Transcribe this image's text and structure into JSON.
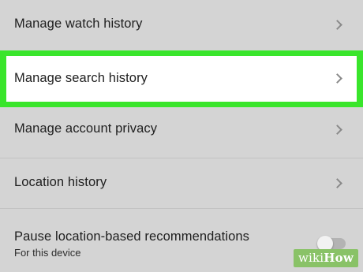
{
  "settings": {
    "items": [
      {
        "label": "Manage watch history",
        "icon": "chevron-right-icon"
      },
      {
        "label": "Manage search history",
        "icon": "chevron-right-icon",
        "highlighted": true
      },
      {
        "label": "Manage account privacy",
        "icon": "chevron-right-icon"
      },
      {
        "label": "Location history",
        "icon": "chevron-right-icon"
      }
    ],
    "pause_location": {
      "label": "Pause location-based recommendations",
      "sublabel": "For this device",
      "toggle_on": false
    }
  },
  "watermark": {
    "prefix": "wiki",
    "suffix": "How"
  },
  "colors": {
    "background": "#d4d4d4",
    "highlight_border": "#39e52b",
    "highlight_fill": "#ffffff",
    "watermark": "#89c267"
  }
}
